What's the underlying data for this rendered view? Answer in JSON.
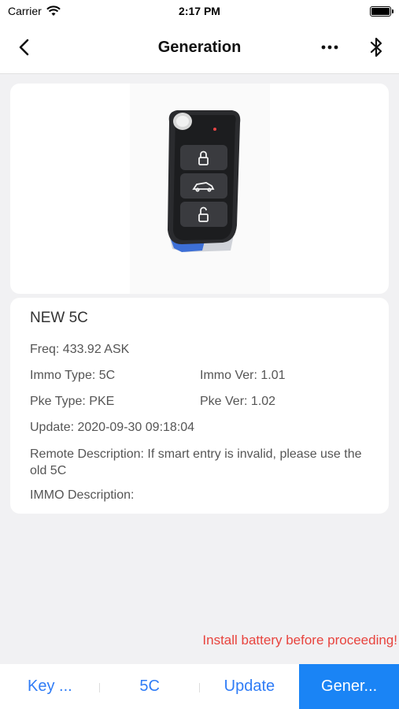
{
  "status_bar": {
    "carrier": "Carrier",
    "time": "2:17 PM"
  },
  "nav": {
    "title": "Generation",
    "back_icon": "chevron-left-icon",
    "more_icon": "ellipsis-icon",
    "bluetooth_icon": "bluetooth-icon"
  },
  "key": {
    "image": "car-key-fob-photo",
    "buttons": [
      "lock-icon",
      "car-trunk-icon",
      "unlock-icon"
    ]
  },
  "info": {
    "name": "NEW 5C",
    "freq": "Freq: 433.92 ASK",
    "immo_type": "Immo Type: 5C",
    "immo_ver": "Immo Ver: 1.01",
    "pke_type": "Pke Type: PKE",
    "pke_ver": "Pke Ver: 1.02",
    "update": "Update: 2020-09-30 09:18:04",
    "remote_description": "Remote Description:  If smart entry is invalid, please use the old 5C",
    "immo_description": "IMMO Description:"
  },
  "warning": "Install battery before proceeding!",
  "bottom_tabs": {
    "key": "Key ...",
    "chip": "5C",
    "update": "Update",
    "generate": "Gener..."
  },
  "colors": {
    "accent": "#1a84f5",
    "tab_text": "#2f7cf6",
    "warning": "#e8433d",
    "background": "#f1f1f3"
  }
}
